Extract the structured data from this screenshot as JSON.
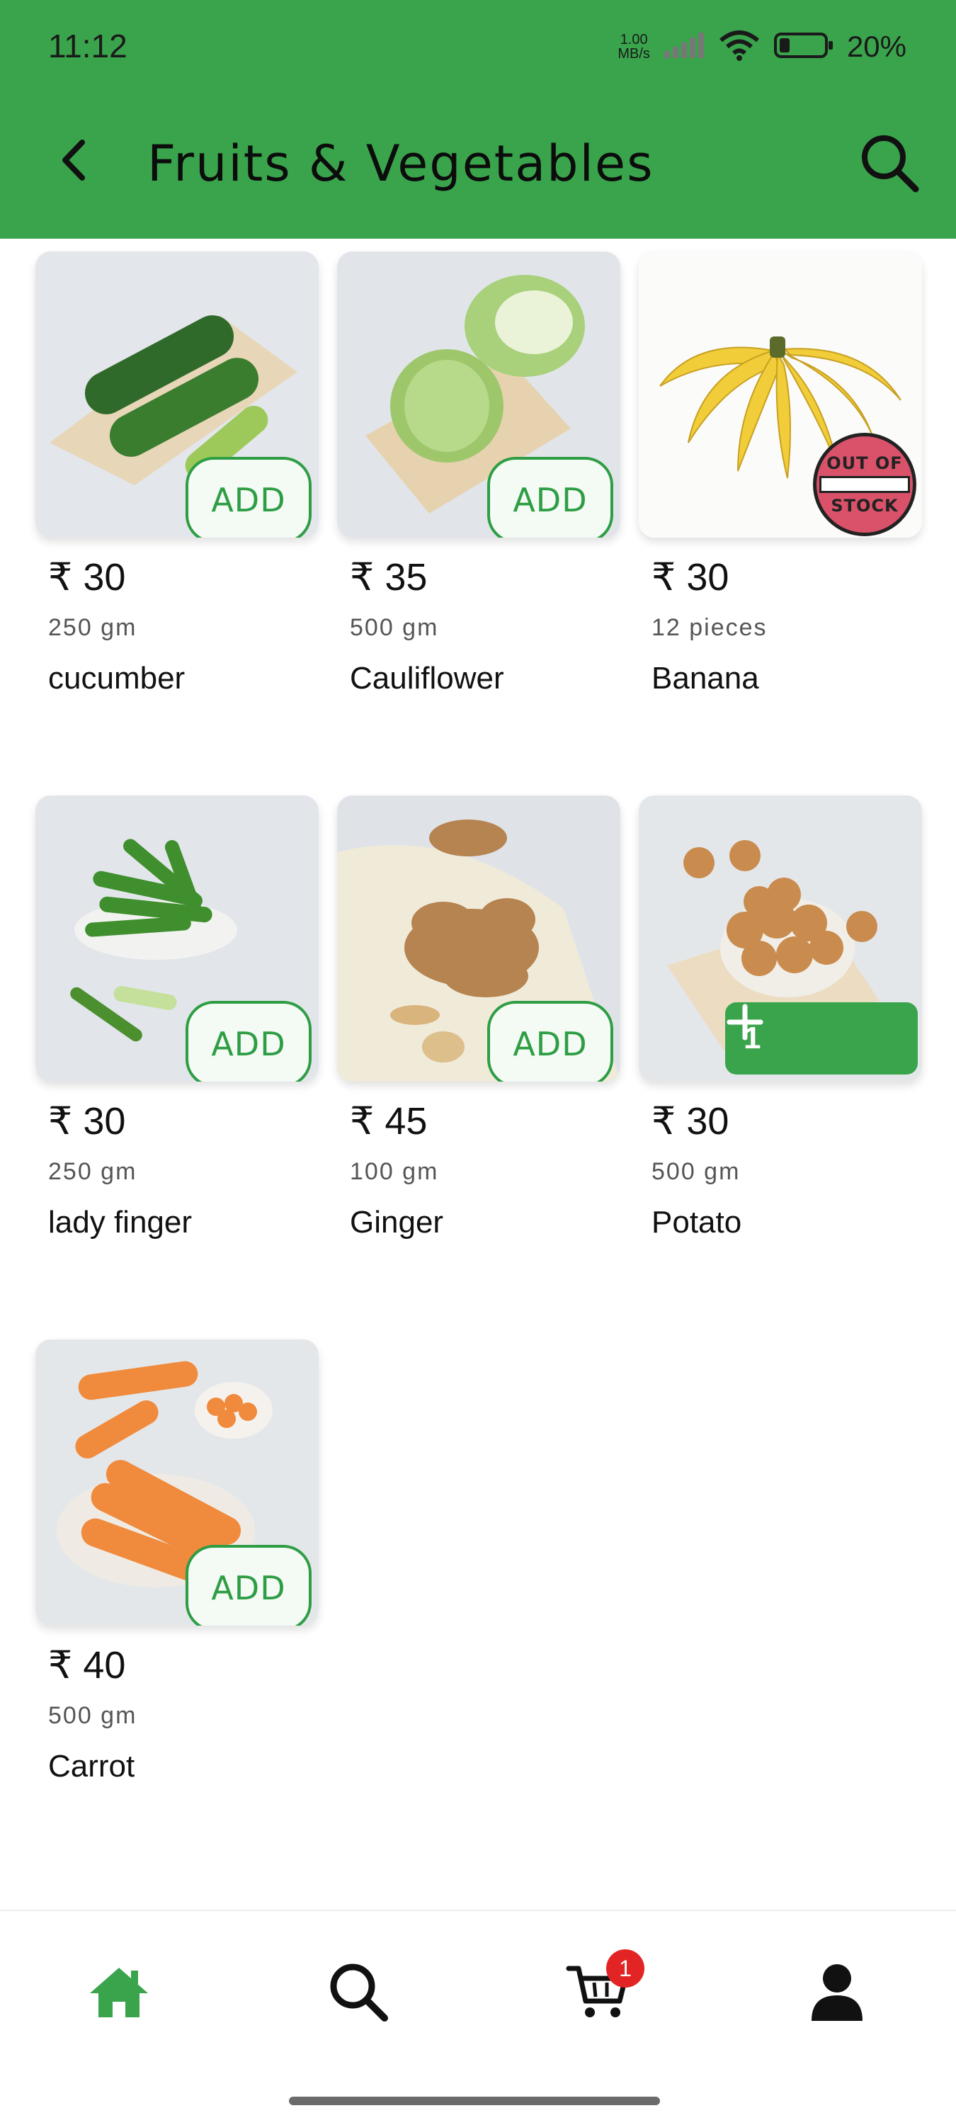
{
  "status_bar": {
    "time": "11:12",
    "net_speed_value": "1.00",
    "net_speed_unit": "MB/s",
    "battery_percent": "20%"
  },
  "header": {
    "title": "Fruits & Vegetables",
    "back_icon": "chevron-left-icon",
    "search_icon": "search-icon",
    "background_color": "#3aa44c"
  },
  "products": [
    {
      "price": "₹ 30",
      "quantity": "250 gm",
      "name": "cucumber",
      "action": "ADD"
    },
    {
      "price": "₹ 35",
      "quantity": "500 gm",
      "name": "Cauliflower",
      "action": "ADD"
    },
    {
      "price": "₹ 30",
      "quantity": "12 pieces",
      "name": "Banana",
      "stamp_top": "OUT OF",
      "stamp_bottom": "STOCK"
    },
    {
      "price": "₹ 30",
      "quantity": "250 gm",
      "name": "lady finger",
      "action": "ADD"
    },
    {
      "price": "₹ 45",
      "quantity": "100 gm",
      "name": "Ginger",
      "action": "ADD"
    },
    {
      "price": "₹ 30",
      "quantity": "500 gm",
      "name": "Potato",
      "cart_count": "1"
    },
    {
      "price": "₹ 40",
      "quantity": "500 gm",
      "name": "Carrot",
      "action": "ADD"
    }
  ],
  "bottom_nav": {
    "items": [
      {
        "icon": "home-icon",
        "active": true
      },
      {
        "icon": "search-icon",
        "active": false
      },
      {
        "icon": "cart-icon",
        "active": false
      },
      {
        "icon": "profile-icon",
        "active": false
      }
    ],
    "cart_badge": "1"
  },
  "colors": {
    "accent": "#3aa44c",
    "add_button_border": "#2e9d44",
    "badge": "#e32424",
    "out_of_stock": "#d9526a"
  }
}
